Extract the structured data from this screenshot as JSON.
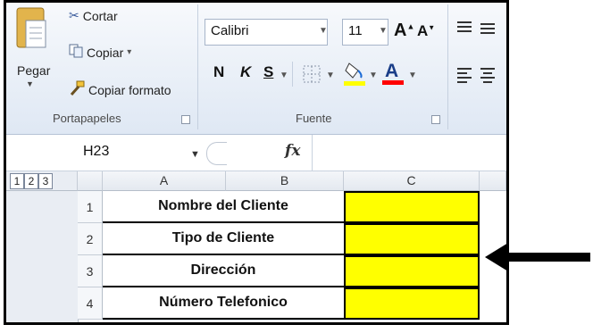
{
  "clipboard": {
    "paste_label": "Pegar",
    "cut_label": "Cortar",
    "copy_label": "Copiar",
    "copy_dropdown_icon": "▾",
    "format_painter_label": "Copiar formato",
    "group_label": "Portapapeles"
  },
  "font": {
    "family": "Calibri",
    "size": "11",
    "bold": "N",
    "italic": "K",
    "underline": "S",
    "group_label": "Fuente",
    "highlight_color": "#ffff00",
    "font_color": "#ff0000"
  },
  "namebox": {
    "value": "H23",
    "fx_label": "fx"
  },
  "outline_levels": [
    "1",
    "2",
    "3"
  ],
  "columns": [
    "A",
    "B",
    "C"
  ],
  "rows": [
    {
      "num": "1",
      "label": "Nombre del Cliente"
    },
    {
      "num": "2",
      "label": "Tipo de Cliente"
    },
    {
      "num": "3",
      "label": "Dirección"
    },
    {
      "num": "4",
      "label": "Número Telefonico"
    }
  ],
  "colors": {
    "input_fill": "#ffff00",
    "arrow": "#000000"
  }
}
